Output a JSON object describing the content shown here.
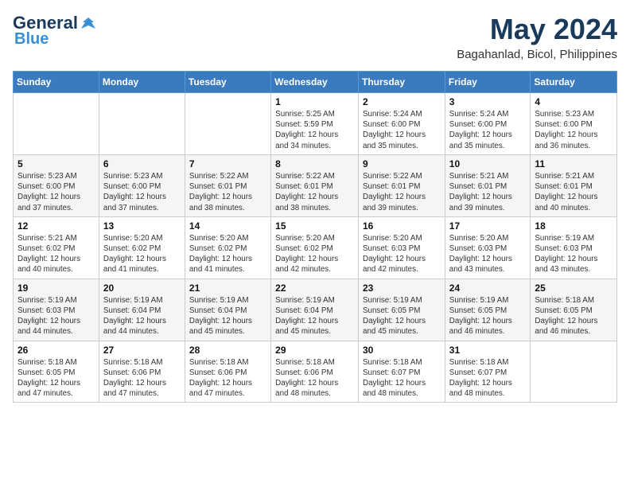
{
  "logo": {
    "line1": "General",
    "line2": "Blue"
  },
  "title": "May 2024",
  "location": "Bagahanlad, Bicol, Philippines",
  "weekdays": [
    "Sunday",
    "Monday",
    "Tuesday",
    "Wednesday",
    "Thursday",
    "Friday",
    "Saturday"
  ],
  "weeks": [
    [
      {
        "day": "",
        "info": ""
      },
      {
        "day": "",
        "info": ""
      },
      {
        "day": "",
        "info": ""
      },
      {
        "day": "1",
        "info": "Sunrise: 5:25 AM\nSunset: 5:59 PM\nDaylight: 12 hours\nand 34 minutes."
      },
      {
        "day": "2",
        "info": "Sunrise: 5:24 AM\nSunset: 6:00 PM\nDaylight: 12 hours\nand 35 minutes."
      },
      {
        "day": "3",
        "info": "Sunrise: 5:24 AM\nSunset: 6:00 PM\nDaylight: 12 hours\nand 35 minutes."
      },
      {
        "day": "4",
        "info": "Sunrise: 5:23 AM\nSunset: 6:00 PM\nDaylight: 12 hours\nand 36 minutes."
      }
    ],
    [
      {
        "day": "5",
        "info": "Sunrise: 5:23 AM\nSunset: 6:00 PM\nDaylight: 12 hours\nand 37 minutes."
      },
      {
        "day": "6",
        "info": "Sunrise: 5:23 AM\nSunset: 6:00 PM\nDaylight: 12 hours\nand 37 minutes."
      },
      {
        "day": "7",
        "info": "Sunrise: 5:22 AM\nSunset: 6:01 PM\nDaylight: 12 hours\nand 38 minutes."
      },
      {
        "day": "8",
        "info": "Sunrise: 5:22 AM\nSunset: 6:01 PM\nDaylight: 12 hours\nand 38 minutes."
      },
      {
        "day": "9",
        "info": "Sunrise: 5:22 AM\nSunset: 6:01 PM\nDaylight: 12 hours\nand 39 minutes."
      },
      {
        "day": "10",
        "info": "Sunrise: 5:21 AM\nSunset: 6:01 PM\nDaylight: 12 hours\nand 39 minutes."
      },
      {
        "day": "11",
        "info": "Sunrise: 5:21 AM\nSunset: 6:01 PM\nDaylight: 12 hours\nand 40 minutes."
      }
    ],
    [
      {
        "day": "12",
        "info": "Sunrise: 5:21 AM\nSunset: 6:02 PM\nDaylight: 12 hours\nand 40 minutes."
      },
      {
        "day": "13",
        "info": "Sunrise: 5:20 AM\nSunset: 6:02 PM\nDaylight: 12 hours\nand 41 minutes."
      },
      {
        "day": "14",
        "info": "Sunrise: 5:20 AM\nSunset: 6:02 PM\nDaylight: 12 hours\nand 41 minutes."
      },
      {
        "day": "15",
        "info": "Sunrise: 5:20 AM\nSunset: 6:02 PM\nDaylight: 12 hours\nand 42 minutes."
      },
      {
        "day": "16",
        "info": "Sunrise: 5:20 AM\nSunset: 6:03 PM\nDaylight: 12 hours\nand 42 minutes."
      },
      {
        "day": "17",
        "info": "Sunrise: 5:20 AM\nSunset: 6:03 PM\nDaylight: 12 hours\nand 43 minutes."
      },
      {
        "day": "18",
        "info": "Sunrise: 5:19 AM\nSunset: 6:03 PM\nDaylight: 12 hours\nand 43 minutes."
      }
    ],
    [
      {
        "day": "19",
        "info": "Sunrise: 5:19 AM\nSunset: 6:03 PM\nDaylight: 12 hours\nand 44 minutes."
      },
      {
        "day": "20",
        "info": "Sunrise: 5:19 AM\nSunset: 6:04 PM\nDaylight: 12 hours\nand 44 minutes."
      },
      {
        "day": "21",
        "info": "Sunrise: 5:19 AM\nSunset: 6:04 PM\nDaylight: 12 hours\nand 45 minutes."
      },
      {
        "day": "22",
        "info": "Sunrise: 5:19 AM\nSunset: 6:04 PM\nDaylight: 12 hours\nand 45 minutes."
      },
      {
        "day": "23",
        "info": "Sunrise: 5:19 AM\nSunset: 6:05 PM\nDaylight: 12 hours\nand 45 minutes."
      },
      {
        "day": "24",
        "info": "Sunrise: 5:19 AM\nSunset: 6:05 PM\nDaylight: 12 hours\nand 46 minutes."
      },
      {
        "day": "25",
        "info": "Sunrise: 5:18 AM\nSunset: 6:05 PM\nDaylight: 12 hours\nand 46 minutes."
      }
    ],
    [
      {
        "day": "26",
        "info": "Sunrise: 5:18 AM\nSunset: 6:05 PM\nDaylight: 12 hours\nand 47 minutes."
      },
      {
        "day": "27",
        "info": "Sunrise: 5:18 AM\nSunset: 6:06 PM\nDaylight: 12 hours\nand 47 minutes."
      },
      {
        "day": "28",
        "info": "Sunrise: 5:18 AM\nSunset: 6:06 PM\nDaylight: 12 hours\nand 47 minutes."
      },
      {
        "day": "29",
        "info": "Sunrise: 5:18 AM\nSunset: 6:06 PM\nDaylight: 12 hours\nand 48 minutes."
      },
      {
        "day": "30",
        "info": "Sunrise: 5:18 AM\nSunset: 6:07 PM\nDaylight: 12 hours\nand 48 minutes."
      },
      {
        "day": "31",
        "info": "Sunrise: 5:18 AM\nSunset: 6:07 PM\nDaylight: 12 hours\nand 48 minutes."
      },
      {
        "day": "",
        "info": ""
      }
    ]
  ]
}
